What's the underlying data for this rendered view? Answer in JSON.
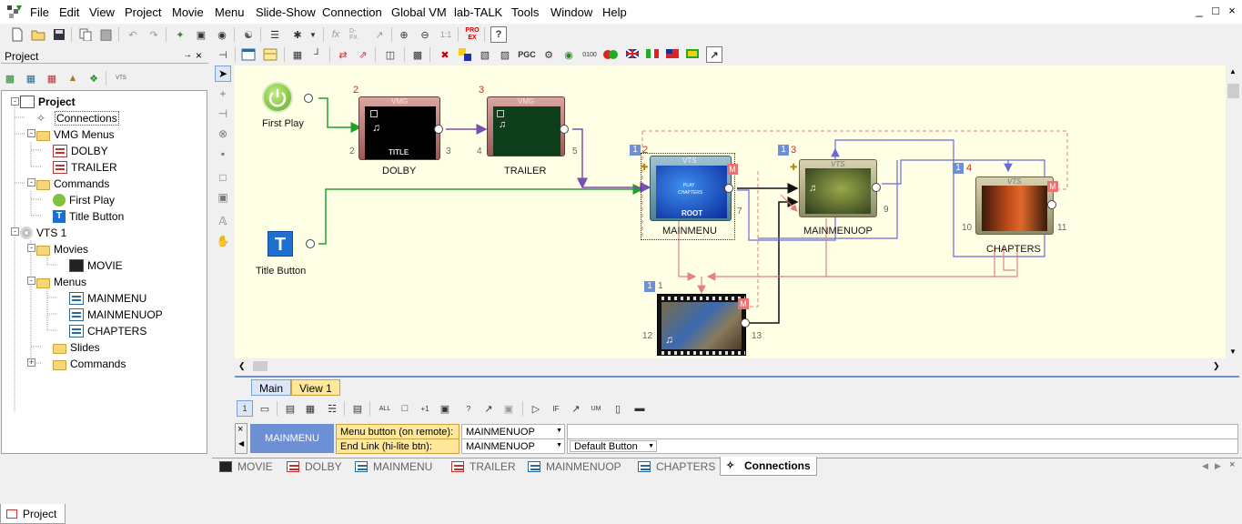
{
  "menubar": {
    "items": [
      "File",
      "Edit",
      "View",
      "Project",
      "Movie",
      "Menu",
      "Slide-Show",
      "Connection",
      "Global VM",
      "lab-TALK",
      "Tools",
      "Window",
      "Help"
    ],
    "window_controls": [
      "_",
      "□",
      "×"
    ]
  },
  "toolbar": {
    "labels": {
      "dfx": "D-FX",
      "zoom_1to1": "1:1",
      "pro_ex": "PRO EX",
      "pgc": "PGC",
      "help": "?",
      "counter": "0100"
    }
  },
  "project_panel": {
    "title": "Project",
    "pin": " →",
    "close": "×",
    "vts_label": "VTS",
    "tree": [
      {
        "label": "Project",
        "bold": true
      },
      {
        "label": "Connections"
      },
      {
        "label": "VMG Menus"
      },
      {
        "label": "DOLBY"
      },
      {
        "label": "TRAILER"
      },
      {
        "label": "Commands"
      },
      {
        "label": "First Play"
      },
      {
        "label": "Title Button"
      },
      {
        "label": "VTS 1"
      },
      {
        "label": "Movies"
      },
      {
        "label": "MOVIE"
      },
      {
        "label": "Menus"
      },
      {
        "label": "MAINMENU"
      },
      {
        "label": "MAINMENUOP"
      },
      {
        "label": "CHAPTERS"
      },
      {
        "label": "Slides"
      },
      {
        "label": "Commands"
      }
    ],
    "bottom_tab": "Project"
  },
  "canvas": {
    "first_play": {
      "label": "First Play"
    },
    "title_button": {
      "label": "Title Button",
      "glyph": "T"
    },
    "dolby": {
      "label": "DOLBY",
      "header": "VMG",
      "caption": "TITLE",
      "red_num": "2",
      "left_num": "2",
      "right_num": "3"
    },
    "trailer": {
      "label": "TRAILER",
      "header": "VMG",
      "red_num": "3",
      "left_num": "4",
      "right_num": "5"
    },
    "mainmenu": {
      "label": "MAINMENU",
      "header": "VTS",
      "caption": "ROOT",
      "badge": "1",
      "red_num": "2",
      "right_num": "7",
      "m": "M",
      "screen_lines": [
        "PLAY",
        "CHAPTERS"
      ]
    },
    "mainmenuop": {
      "label": "MAINMENUOP",
      "header": "VTS",
      "badge": "1",
      "red_num": "3",
      "right_num": "9"
    },
    "chapters": {
      "label": "CHAPTERS",
      "header": "VTS",
      "badge": "1",
      "red_num": "4",
      "left_num": "10",
      "right_num": "11",
      "m": "M"
    },
    "movie": {
      "badge": "1",
      "top_num": "1",
      "left_num": "12",
      "right_num": "13",
      "m": "M"
    }
  },
  "view_tabs": [
    "Main",
    "View 1"
  ],
  "prop_toolbar": {
    "first": "1"
  },
  "properties": {
    "close": "×",
    "node_name": "MAINMENU",
    "rows": [
      {
        "label": "Menu button (on remote):",
        "value": "MAINMENUOP",
        "extra": ""
      },
      {
        "label": "End Link (hi-lite btn):",
        "value": "MAINMENUOP",
        "extra": "Default Button"
      }
    ]
  },
  "doc_tabs": [
    "MOVIE",
    "DOLBY",
    "MAINMENU",
    "TRAILER",
    "MAINMENUOP",
    "CHAPTERS",
    "Connections"
  ],
  "active_doc_tab": "Connections",
  "colors": {
    "canvas_bg": "#ffffe6",
    "link_green": "#22a02a",
    "link_purple": "#7b4fb0",
    "link_blue": "#6b6bd8",
    "link_pink": "#e48080",
    "accent_blue": "#6d8fd6"
  }
}
